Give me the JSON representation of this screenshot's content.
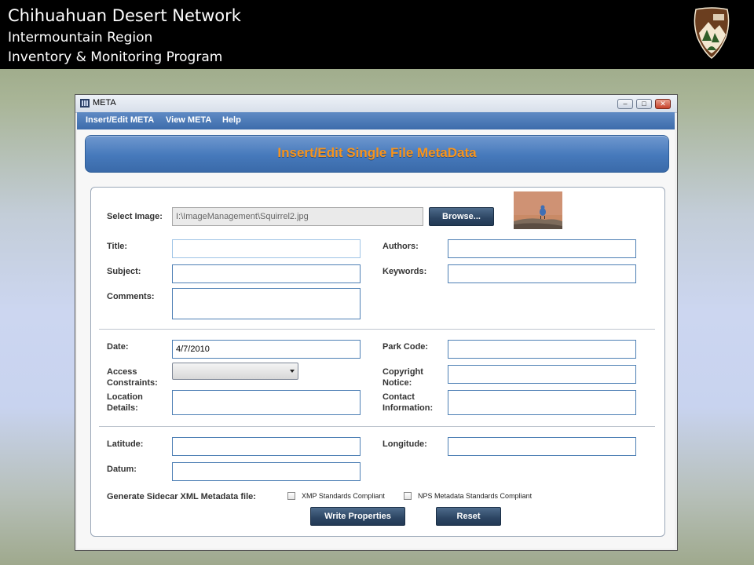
{
  "slide_header": {
    "title": "Chihuahuan Desert Network",
    "subtitle": "Intermountain Region",
    "program": "Inventory & Monitoring Program"
  },
  "window": {
    "title": "META",
    "controls": {
      "minimize": "–",
      "maximize": "□",
      "close": "✕"
    }
  },
  "menu": {
    "items": [
      "Insert/Edit META",
      "View META",
      "Help"
    ]
  },
  "banner": {
    "title": "Insert/Edit Single File MetaData"
  },
  "form": {
    "select_image": {
      "label": "Select Image:",
      "value": "I:\\ImageManagement\\Squirrel2.jpg",
      "browse_label": "Browse..."
    },
    "title": {
      "label": "Title:",
      "value": ""
    },
    "authors": {
      "label": "Authors:",
      "value": ""
    },
    "subject": {
      "label": "Subject:",
      "value": ""
    },
    "keywords": {
      "label": "Keywords:",
      "value": ""
    },
    "comments": {
      "label": "Comments:",
      "value": ""
    },
    "date": {
      "label": "Date:",
      "value": "4/7/2010"
    },
    "park_code": {
      "label": "Park Code:",
      "value": ""
    },
    "access_constraints": {
      "label_line1": "Access",
      "label_line2": "Constraints:",
      "value": ""
    },
    "copyright_notice": {
      "label_line1": "Copyright",
      "label_line2": "Notice:",
      "value": ""
    },
    "location_details": {
      "label_line1": "Location",
      "label_line2": "Details:",
      "value": ""
    },
    "contact_information": {
      "label_line1": "Contact",
      "label_line2": "Information:",
      "value": ""
    },
    "latitude": {
      "label": "Latitude:",
      "value": ""
    },
    "longitude": {
      "label": "Longitude:",
      "value": ""
    },
    "datum": {
      "label": "Datum:",
      "value": ""
    },
    "sidecar": {
      "label": "Generate Sidecar XML Metadata file:",
      "xmp_label": "XMP Standards Compliant",
      "xmp_checked": false,
      "nps_label": "NPS Metadata Standards Compliant",
      "nps_checked": false
    },
    "write_label": "Write Properties",
    "reset_label": "Reset"
  },
  "colors": {
    "menu_blue": "#3d6cab",
    "banner_text": "#f7941d",
    "button_dark": "#2c4563",
    "field_border": "#4d7fb4"
  },
  "icons": {
    "app": "meta-app-icon",
    "logo": "nps-arrowhead-logo",
    "thumbnail": "image-thumbnail"
  }
}
